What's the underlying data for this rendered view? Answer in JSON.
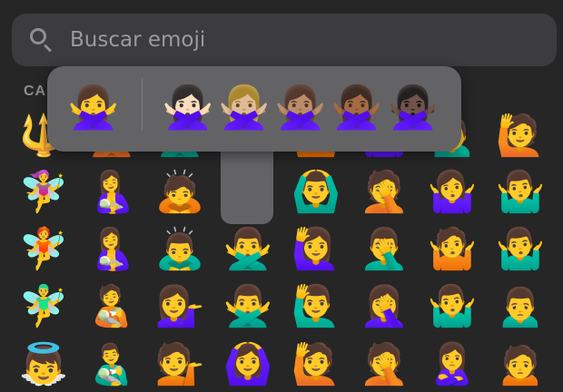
{
  "search": {
    "placeholder": "Buscar emoji",
    "icon": "search-icon"
  },
  "section": {
    "label": "CA"
  },
  "grid": {
    "rows": [
      [
        "🔱",
        "🙅",
        "🙅‍♂️",
        "🙇",
        "🙆",
        "🤷‍♀️",
        "🙍‍♂️",
        "🙋",
        "🙎",
        "🙍‍♂️"
      ],
      [
        "🧚‍♀️",
        "🤱",
        "🙇",
        "",
        "🙆‍♂️",
        "🤦",
        "🤷‍♀️",
        "🤷‍♂️",
        "🙋‍♂️",
        "🧑"
      ],
      [
        "🧚",
        "🤱",
        "🙇‍♂️",
        "🙅‍♂️",
        "🙋‍♀️",
        "🤦‍♂️",
        "🤷",
        "🤷‍♂️",
        "👩",
        "🧑"
      ],
      [
        "🧚‍♂️",
        "🧑‍🍼",
        "💁‍♀️",
        "🙅‍♂️",
        "🙋‍♂️",
        "🤦‍♀️",
        "🤷‍♂️",
        "🙍‍♂️",
        "🙍",
        "🧑"
      ],
      [
        "👼",
        "👨‍🍼",
        "💁",
        "🙆‍♀️",
        "🙋",
        "🤦",
        "🙎‍♀️",
        "🙍",
        "🙎‍♂️",
        "🧑"
      ]
    ]
  },
  "popup": {
    "default": "🙅‍♀️",
    "variants": [
      "🙅🏻‍♀️",
      "🙅🏼‍♀️",
      "🙅🏽‍♀️",
      "🙅🏾‍♀️",
      "🙅🏿‍♀️"
    ]
  }
}
